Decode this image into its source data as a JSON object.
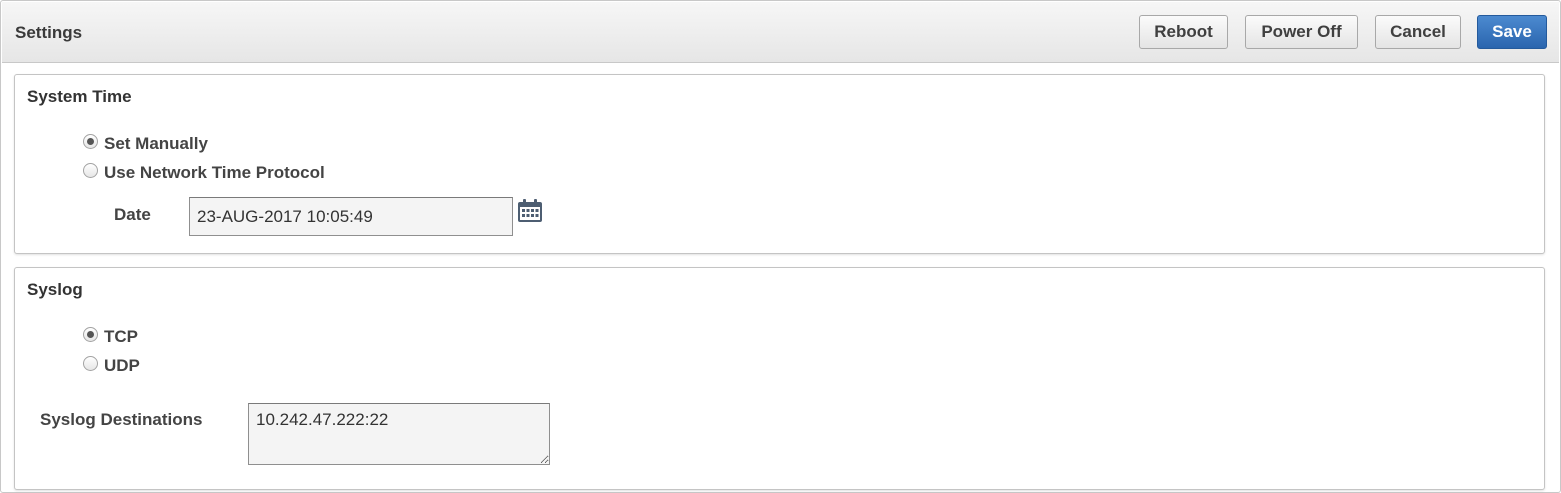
{
  "header": {
    "title": "Settings",
    "buttons": {
      "reboot": "Reboot",
      "power_off": "Power Off",
      "cancel": "Cancel",
      "save": "Save"
    }
  },
  "system_time": {
    "title": "System Time",
    "options": [
      {
        "label": "Set Manually",
        "checked": true
      },
      {
        "label": "Use Network Time Protocol",
        "checked": false
      }
    ],
    "date_label": "Date",
    "date_value": "23-AUG-2017 10:05:49",
    "calendar_icon": "calendar-icon"
  },
  "syslog": {
    "title": "Syslog",
    "options": [
      {
        "label": "TCP",
        "checked": true
      },
      {
        "label": "UDP",
        "checked": false
      }
    ],
    "destinations_label": "Syslog Destinations",
    "destinations_value": "10.242.47.222:22"
  },
  "colors": {
    "primary_button": "#2f6db5",
    "header_bg": "#ececec"
  }
}
